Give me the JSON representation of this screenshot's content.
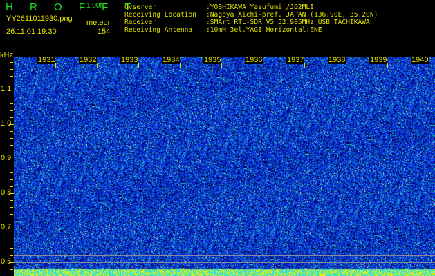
{
  "header": {
    "app_name": "H R O F F T",
    "version": "1.00f",
    "filename": "YY2611011930.png",
    "mode": "meteor",
    "datetime": "26.11.01 19:30",
    "count": "154"
  },
  "info": [
    {
      "label": "Ovserver",
      "value": ":YOSHIKAWA Yasufumi /JG2MLI"
    },
    {
      "label": "Receiving Location",
      "value": ":Nagoya Aichi-pref. JAPAN (136.90E, 35.20N)"
    },
    {
      "label": "Receiver",
      "value": ":SMArt RTL-SDR V5 52.905MHz USB TACHIKAWA"
    },
    {
      "label": "Receiving Antenna",
      "value": ":10mH 3el.YAGI Horizontal:ENE"
    }
  ],
  "spectrogram": {
    "y_unit": "kHz",
    "y_labels": [
      "1.1",
      "1.0",
      "0.9",
      "0.8",
      "0.7",
      "0.6"
    ],
    "time_labels": [
      "1931",
      "1932",
      "1933",
      "1934",
      "1935",
      "1936",
      "1937",
      "1938",
      "1939",
      "1940"
    ],
    "colors": {
      "background": "#1020c0",
      "noise_high": "#30e0c0",
      "bottom_low": "#20e0f0",
      "bottom_high": "#f0f000"
    }
  }
}
